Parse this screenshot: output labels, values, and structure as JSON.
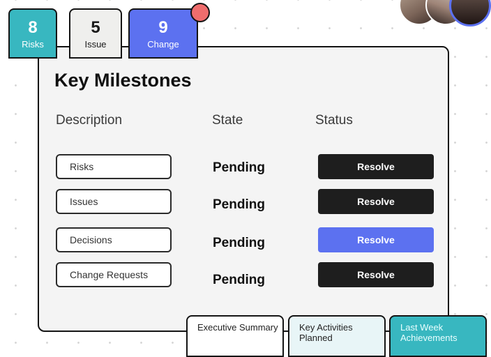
{
  "counters": [
    {
      "count": "8",
      "label": "Risks",
      "color": "#38b7c0"
    },
    {
      "count": "5",
      "label": "Issue",
      "color": "#efefed"
    },
    {
      "count": "9",
      "label": "Change",
      "color": "#5c71f0"
    }
  ],
  "notification_color": "#ef6d6d",
  "card": {
    "title": "Key Milestones",
    "headers": {
      "description": "Description",
      "state": "State",
      "status": "Status"
    },
    "rows": [
      {
        "description": "Risks",
        "state": "Pending",
        "action": "Resolve",
        "highlighted": false
      },
      {
        "description": "Issues",
        "state": "Pending",
        "action": "Resolve",
        "highlighted": false
      },
      {
        "description": "Decisions",
        "state": "Pending",
        "action": "Resolve",
        "highlighted": true
      },
      {
        "description": "Change Requests",
        "state": "Pending",
        "action": "Resolve",
        "highlighted": false
      }
    ]
  },
  "bottom_tabs": [
    {
      "label": "Executive Summary"
    },
    {
      "label": "Key Activities Planned"
    },
    {
      "label": "Last Week Achievements"
    }
  ],
  "colors": {
    "accent": "#5c71f0",
    "teal": "#38b7c0",
    "button_dark": "#1e1e1e"
  }
}
